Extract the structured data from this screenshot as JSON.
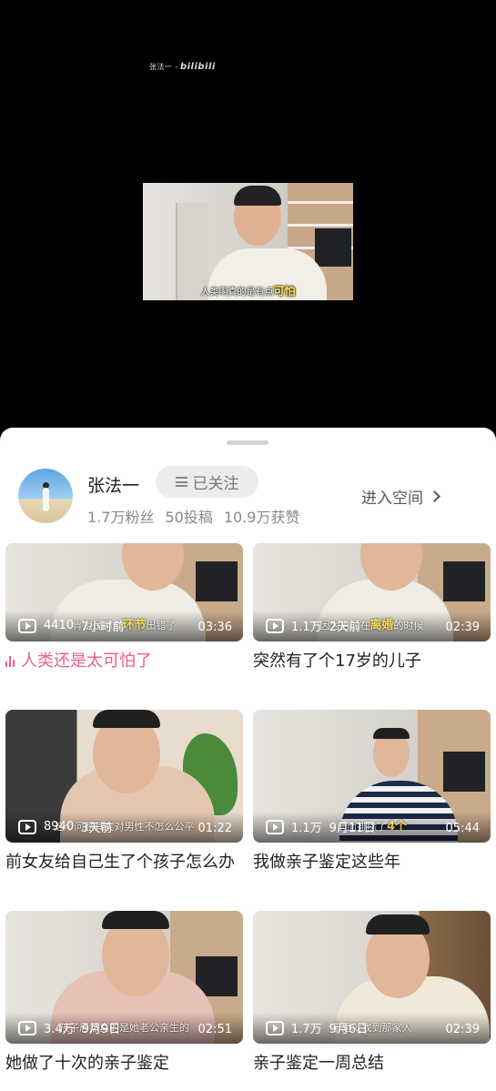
{
  "player": {
    "watermark_user": "张法一 -",
    "watermark_brand": "bilibili",
    "caption_plain": "人类啊真的是有点",
    "caption_highlight": "可怕"
  },
  "uploader": {
    "name": "张法一",
    "follow_label": "已关注",
    "fans": "1.7万粉丝",
    "posts": "50投稿",
    "likes": "10.9万获赞",
    "enter_space": "进入空间"
  },
  "videos": [
    {
      "views": "4410",
      "time": "7小时前",
      "duration": "03:36",
      "title": "人类还是太可怕了",
      "playing": true,
      "sub_plain": "肯定是哪个",
      "sub_highlight": "环节",
      "sub_tail": "出错了"
    },
    {
      "views": "1.1万",
      "time": "2天前",
      "duration": "02:39",
      "title": "突然有了个17岁的儿子",
      "playing": false,
      "sub_plain": "因为当时在",
      "sub_highlight": "离婚",
      "sub_tail": "的时候"
    },
    {
      "views": "8940",
      "time": "3天前",
      "duration": "01:22",
      "title": "前女友给自己生了个孩子怎么办",
      "playing": false,
      "sub_plain": "这个问题其实对男性不怎么公平",
      "sub_highlight": "",
      "sub_tail": ""
    },
    {
      "views": "1.1万",
      "time": "9月11日",
      "duration": "05:44",
      "title": "我做亲子鉴定这些年",
      "playing": false,
      "sub_plain": "前面排除了",
      "sub_highlight": "4个",
      "sub_tail": ""
    },
    {
      "views": "3.4万",
      "time": "9月9日",
      "duration": "02:51",
      "title": "她做了十次的亲子鉴定",
      "playing": false,
      "sub_plain": "孩子居然真的是她老公亲生的",
      "sub_highlight": "",
      "sub_tail": ""
    },
    {
      "views": "1.7万",
      "time": "9月6日",
      "duration": "02:39",
      "title": "亲子鉴定一周总结",
      "playing": false,
      "sub_plain": "于是就找到那家人",
      "sub_highlight": "",
      "sub_tail": ""
    }
  ]
}
